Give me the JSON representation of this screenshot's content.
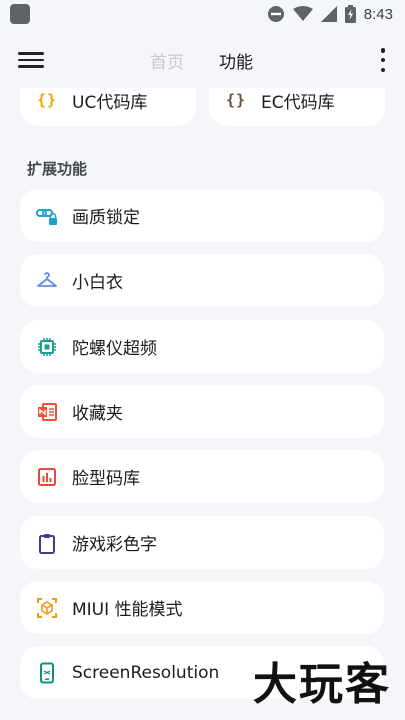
{
  "status_bar": {
    "time": "8:43"
  },
  "appbar": {
    "tabs": [
      {
        "label": "首页"
      },
      {
        "label": "功能"
      }
    ]
  },
  "top_cards": [
    {
      "label": "UC代码库",
      "icon": "braces-icon",
      "color": "#f0a400"
    },
    {
      "label": "EC代码库",
      "icon": "braces-icon",
      "color": "#6d4c3d"
    }
  ],
  "section": {
    "title": "扩展功能"
  },
  "items": [
    {
      "label": "画质锁定",
      "icon": "link-lock-icon",
      "color": "#1aa3c8"
    },
    {
      "label": "小白衣",
      "icon": "hanger-icon",
      "color": "#5b8fe6"
    },
    {
      "label": "陀螺仪超频",
      "icon": "chip-icon",
      "color": "#1a9e8f"
    },
    {
      "label": "收藏夹",
      "icon": "notebook-icon",
      "color": "#e8533a"
    },
    {
      "label": "脸型码库",
      "icon": "bar-chart-icon",
      "color": "#e64a3a"
    },
    {
      "label": "游戏彩色字",
      "icon": "clipboard-icon",
      "color": "#3a3f8f"
    },
    {
      "label": "MIUI 性能模式",
      "icon": "cube-scan-icon",
      "color": "#f09a1a"
    },
    {
      "label": "ScreenResolution",
      "icon": "phone-icon",
      "color": "#0f8f7f"
    }
  ],
  "watermark": "大玩客"
}
